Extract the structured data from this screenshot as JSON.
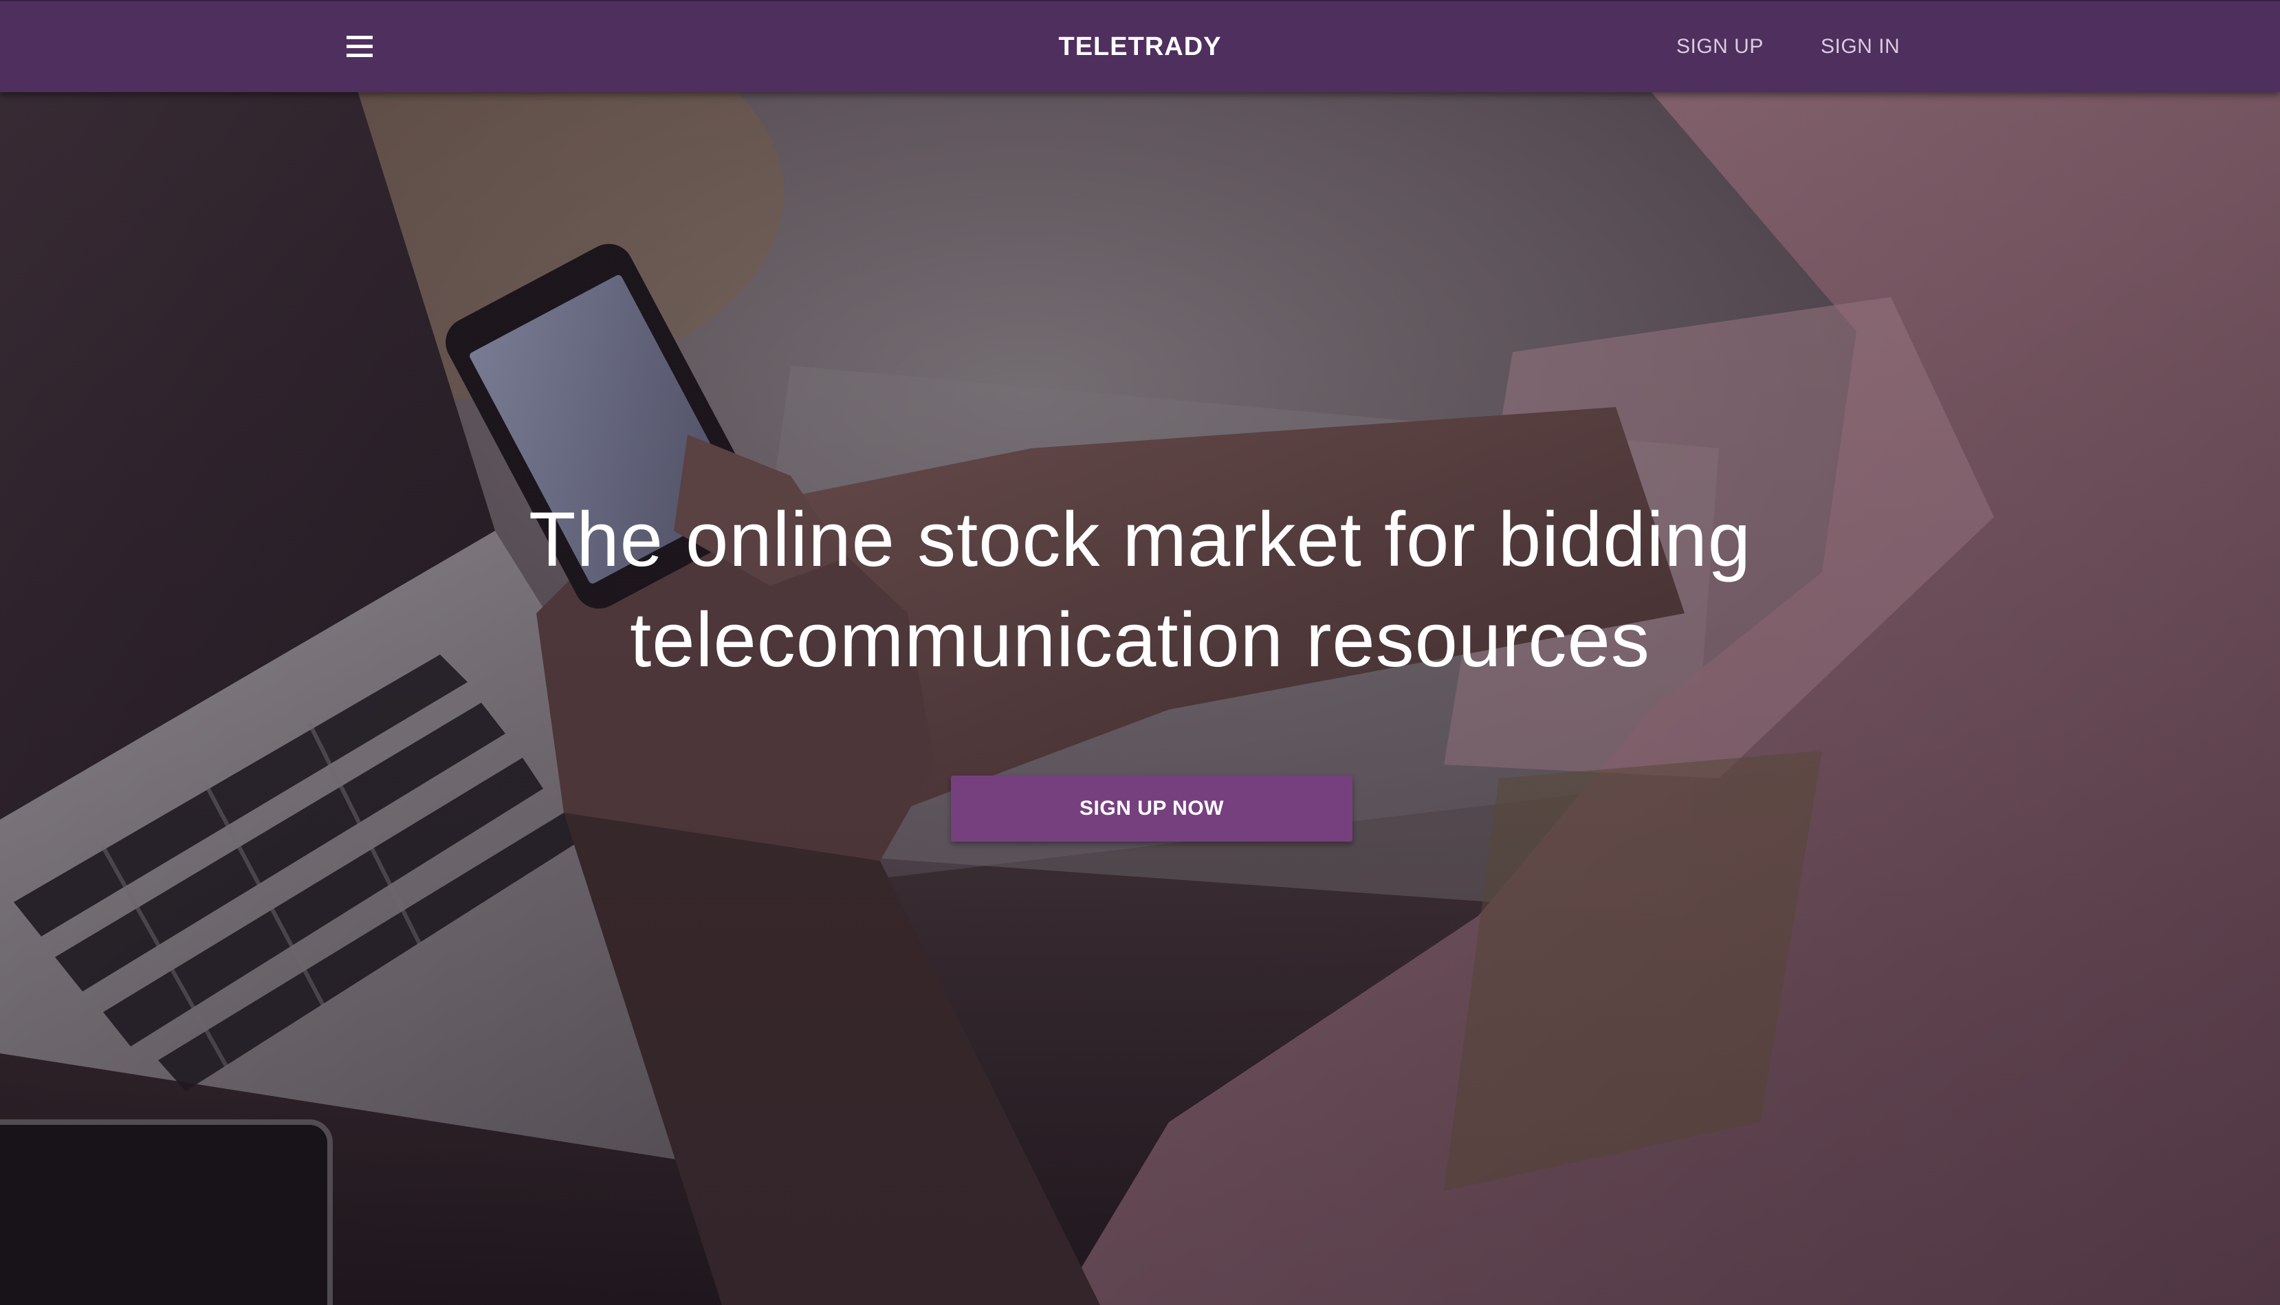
{
  "header": {
    "brand": "TELETRADY",
    "menu_icon": "hamburger-menu-icon",
    "nav": {
      "sign_up": "SIGN UP",
      "sign_in": "SIGN IN"
    },
    "background_color": "#4f2f5e"
  },
  "hero": {
    "headline_line1": "The online stock market for bidding",
    "headline_line2": "telecommunication resources",
    "cta_label": "SIGN UP NOW",
    "cta_color": "#76407f"
  }
}
